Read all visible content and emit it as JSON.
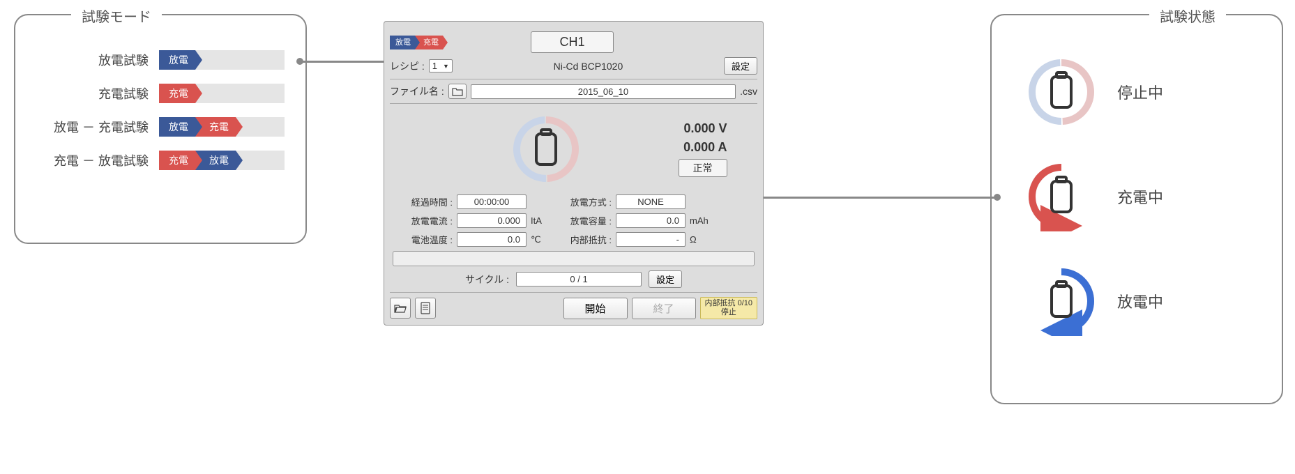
{
  "left_callout": {
    "title": "試験モード",
    "rows": [
      {
        "label": "放電試験",
        "tags": [
          {
            "text": "放電",
            "color": "blue"
          }
        ]
      },
      {
        "label": "充電試験",
        "tags": [
          {
            "text": "充電",
            "color": "red"
          }
        ]
      },
      {
        "label": "放電 － 充電試験",
        "tags": [
          {
            "text": "放電",
            "color": "blue"
          },
          {
            "text": "充電",
            "color": "red"
          }
        ]
      },
      {
        "label": "充電 － 放電試験",
        "tags": [
          {
            "text": "充電",
            "color": "red"
          },
          {
            "text": "放電",
            "color": "blue"
          }
        ]
      }
    ]
  },
  "right_callout": {
    "title": "試験状態",
    "rows": [
      {
        "label": "停止中",
        "state": "stopped"
      },
      {
        "label": "充電中",
        "state": "charging"
      },
      {
        "label": "放電中",
        "state": "discharging"
      }
    ]
  },
  "panel": {
    "mode_tags": [
      {
        "text": "放電",
        "color": "blue"
      },
      {
        "text": "充電",
        "color": "red"
      }
    ],
    "channel": "CH1",
    "recipe_label": "レシピ",
    "recipe_value": "1",
    "recipe_name": "Ni-Cd BCP1020",
    "settings_btn": "設定",
    "filename_label": "ファイル名",
    "filename_value": "2015_06_10",
    "filename_ext": ".csv",
    "voltage": "0.000 V",
    "current": "0.000 A",
    "status": "正常",
    "fields": {
      "elapsed_label": "経過時間",
      "elapsed_value": "00:00:00",
      "dmethod_label": "放電方式",
      "dmethod_value": "NONE",
      "dcurrent_label": "放電電流",
      "dcurrent_value": "0.000",
      "dcurrent_unit": "ItA",
      "dcap_label": "放電容量",
      "dcap_value": "0.0",
      "dcap_unit": "mAh",
      "temp_label": "電池温度",
      "temp_value": "0.0",
      "temp_unit": "℃",
      "ir_label": "内部抵抗",
      "ir_value": "-",
      "ir_unit": "Ω"
    },
    "cycle_label": "サイクル",
    "cycle_value": "0 / 1",
    "cycle_settings_btn": "設定",
    "start_btn": "開始",
    "end_btn": "終了",
    "ir_box_line1": "内部抵抗 0/10",
    "ir_box_line2": "停止"
  }
}
